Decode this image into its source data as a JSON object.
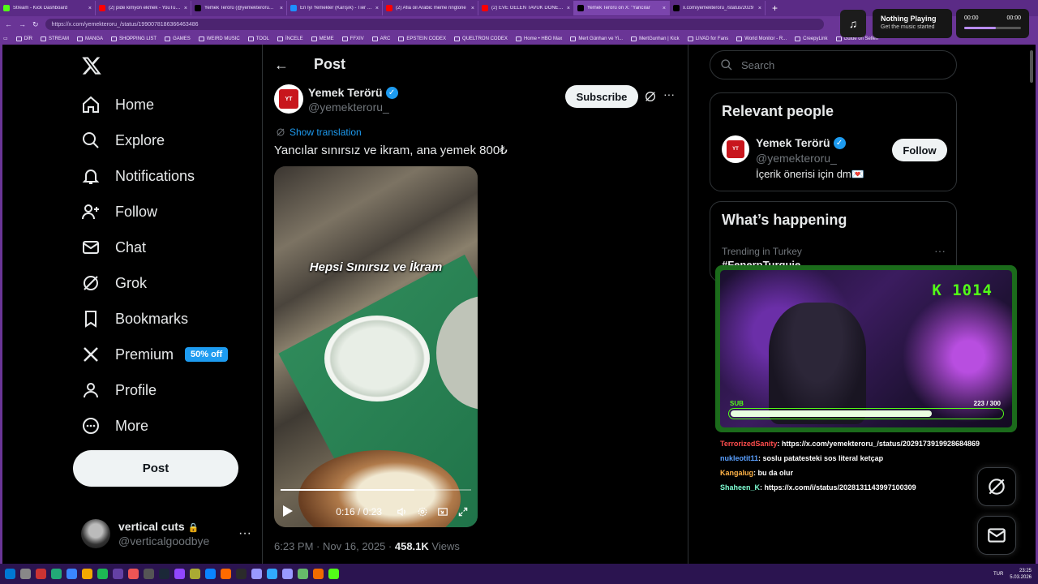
{
  "browser": {
    "tabs": [
      {
        "title": "Stream - Kick Dashboard",
        "icon": "kick-icon",
        "color": "#53fc18"
      },
      {
        "title": "(2) pide kimyon ekmek - YouTube",
        "icon": "youtube-icon",
        "color": "#ff0000"
      },
      {
        "title": "Yemek Terörü (@yemekteroru_) / X",
        "icon": "x-icon",
        "color": "#000000"
      },
      {
        "title": "En İyi Yemekler (Karışık) - Tier List",
        "icon": "tierlist-icon",
        "color": "#1e90ff"
      },
      {
        "title": "(2) Afia oil Arabic meme ringtone",
        "icon": "youtube-icon",
        "color": "#ff0000"
      },
      {
        "title": "(2) EVE GELEN TAVUK DÖNERCİLİ",
        "icon": "youtube-icon",
        "color": "#ff0000"
      },
      {
        "title": "Yemek Terörü on X: \"Yancılar",
        "icon": "x-icon",
        "color": "#000000"
      },
      {
        "title": "x.com/yemekteroru_/status/2029",
        "icon": "x-icon",
        "color": "#000000"
      }
    ],
    "new_tab": "+",
    "url": "https://x.com/yemekteroru_/status/1990078186366463486",
    "bookmarks": [
      "DİR",
      "STREAM",
      "MANGA",
      "SHOPPING LIST",
      "GAMES",
      "WEIRD MUSIC",
      "TOOL",
      "İNCELE",
      "MEME",
      "FFXIV",
      "ARC",
      "EPSTEIN CODEX",
      "QUELTRON CODEX",
      "Home • HBO Max",
      "Mert Günhan ve Yi...",
      "MertGunhan | Kick",
      "LIVAD for Fans",
      "World Monitor - R...",
      "CreepyLink",
      "Guide on Sellen"
    ]
  },
  "player": {
    "title": "Nothing Playing",
    "subtitle": "Get the music started",
    "time_start": "00:00",
    "time_end": "00:00",
    "progress": 0.56
  },
  "sidebar": {
    "items": [
      {
        "label": "Home",
        "icon": "home-icon"
      },
      {
        "label": "Explore",
        "icon": "search-icon"
      },
      {
        "label": "Notifications",
        "icon": "bell-icon"
      },
      {
        "label": "Follow",
        "icon": "person-add-icon"
      },
      {
        "label": "Chat",
        "icon": "mail-icon"
      },
      {
        "label": "Grok",
        "icon": "grok-icon"
      },
      {
        "label": "Bookmarks",
        "icon": "bookmark-icon"
      },
      {
        "label": "Premium",
        "icon": "x-logo-icon"
      },
      {
        "label": "Profile",
        "icon": "person-icon"
      },
      {
        "label": "More",
        "icon": "more-circle-icon"
      }
    ],
    "premium_badge": "50% off",
    "post_button": "Post",
    "account": {
      "name": "vertical cuts",
      "lock": "🔒",
      "handle": "@verticalgoodbye",
      "more": "···"
    }
  },
  "post": {
    "header": "Post",
    "author": {
      "name": "Yemek Terörü",
      "handle": "@yemekteroru_",
      "avatar_text": "YEMEK TERÖRÜ"
    },
    "subscribe": "Subscribe",
    "show_translation": "Show translation",
    "text": "Yancılar sınırsız ve ikram, ana yemek 800₺",
    "video": {
      "caption": "Hepsi Sınırsız ve İkram",
      "current_time": "0:16",
      "duration": "0:23",
      "time_display": "0:16 / 0:23",
      "progress": 0.7
    },
    "timestamp": "6:23 PM · Nov 16, 2025 · ",
    "views_count": "458.1K",
    "views_label": " Views"
  },
  "right": {
    "search_placeholder": "Search",
    "relevant": {
      "title": "Relevant people",
      "name": "Yemek Terörü",
      "handle": "@yemekteroru_",
      "bio": "İçerik önerisi için dm💌",
      "follow": "Follow"
    },
    "happening": {
      "title": "What’s happening",
      "trend_context": "Trending in Turkey",
      "trend_name": "#FenerpTurquie",
      "more": "···"
    }
  },
  "stream_overlay": {
    "kick_count": "K 1014",
    "sub_label": "SUB",
    "sub_count": "223 / 300",
    "sub_current": 223,
    "sub_goal": 300,
    "chat": [
      {
        "user": "TerrorizedSanity",
        "user_color": "#ff4d4d",
        "message": ": https://x.com/yemekteroru_/status/2029173919928684869"
      },
      {
        "user": "nukleotit11",
        "user_color": "#5aa0ff",
        "message": ": soslu patatesteki sos literal ketçap"
      },
      {
        "user": "Kangalug",
        "user_color": "#ffb347",
        "message": ": bu da olur"
      },
      {
        "user": "Shaheen_K",
        "user_color": "#7fffd4",
        "message": ": https://x.com/i/status/2028131143997100309"
      }
    ]
  },
  "taskbar": {
    "lang": "TUR",
    "time": "23:25",
    "date": "5.03.2026"
  }
}
